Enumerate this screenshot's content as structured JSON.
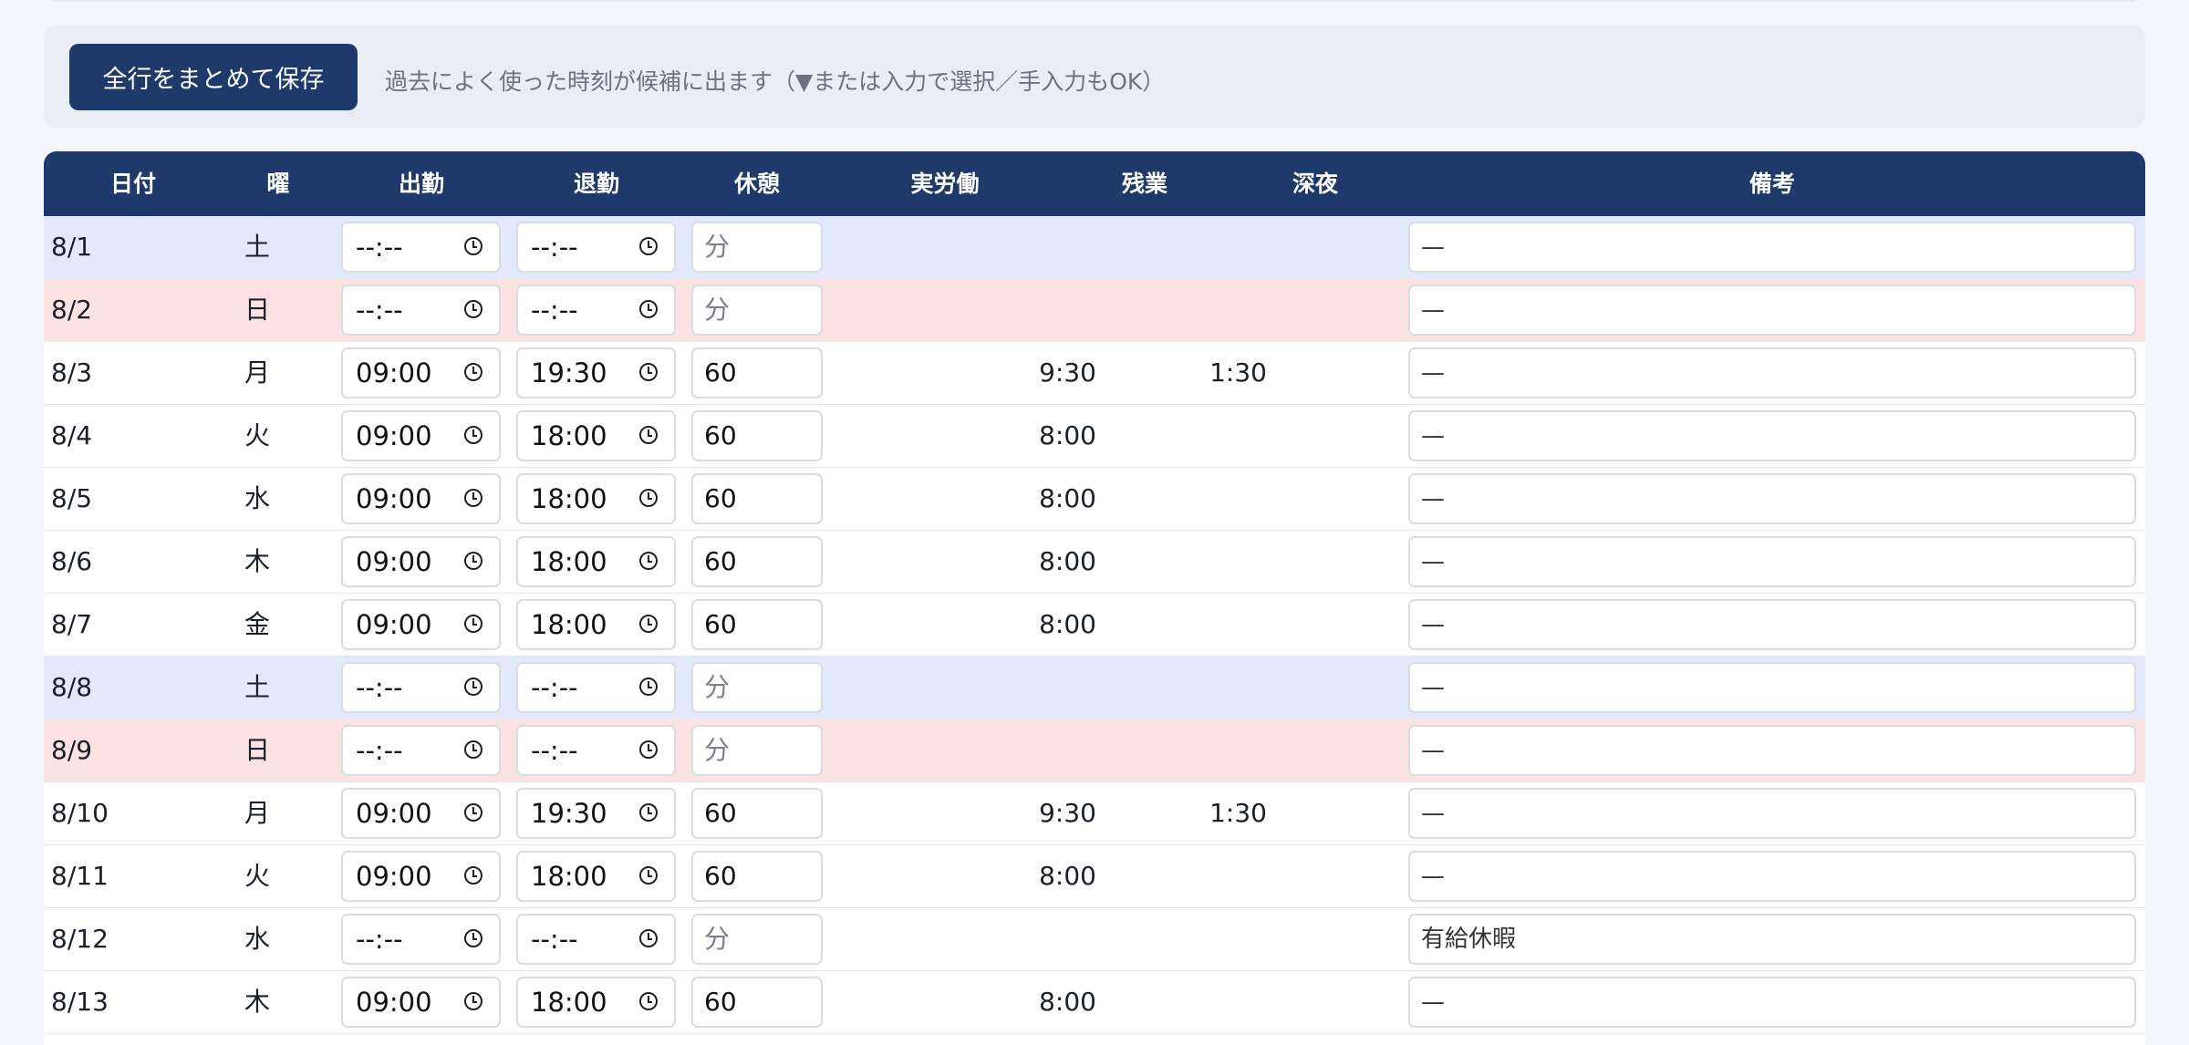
{
  "toolbar": {
    "save_label": "全行をまとめて保存",
    "hint": "過去によく使った時刻が候補に出ます（▼または入力で選択／手入力もOK）"
  },
  "table": {
    "headers": [
      "日付",
      "曜",
      "出勤",
      "退勤",
      "休憩",
      "実労働",
      "残業",
      "深夜",
      "備考"
    ],
    "rows": [
      {
        "date": "8/1",
        "dow": "土",
        "type": "sat",
        "start": "--:--",
        "end": "--:--",
        "break": "",
        "break_placeholder": "分",
        "work": "",
        "overtime": "",
        "night": "",
        "note": "—"
      },
      {
        "date": "8/2",
        "dow": "日",
        "type": "sun",
        "start": "--:--",
        "end": "--:--",
        "break": "",
        "break_placeholder": "分",
        "work": "",
        "overtime": "",
        "night": "",
        "note": "—"
      },
      {
        "date": "8/3",
        "dow": "月",
        "type": "weekday",
        "start": "09:00",
        "end": "19:30",
        "break": "60",
        "break_placeholder": "分",
        "work": "9:30",
        "overtime": "1:30",
        "night": "",
        "note": "—"
      },
      {
        "date": "8/4",
        "dow": "火",
        "type": "weekday",
        "start": "09:00",
        "end": "18:00",
        "break": "60",
        "break_placeholder": "分",
        "work": "8:00",
        "overtime": "",
        "night": "",
        "note": "—"
      },
      {
        "date": "8/5",
        "dow": "水",
        "type": "weekday",
        "start": "09:00",
        "end": "18:00",
        "break": "60",
        "break_placeholder": "分",
        "work": "8:00",
        "overtime": "",
        "night": "",
        "note": "—"
      },
      {
        "date": "8/6",
        "dow": "木",
        "type": "weekday",
        "start": "09:00",
        "end": "18:00",
        "break": "60",
        "break_placeholder": "分",
        "work": "8:00",
        "overtime": "",
        "night": "",
        "note": "—"
      },
      {
        "date": "8/7",
        "dow": "金",
        "type": "weekday",
        "start": "09:00",
        "end": "18:00",
        "break": "60",
        "break_placeholder": "分",
        "work": "8:00",
        "overtime": "",
        "night": "",
        "note": "—"
      },
      {
        "date": "8/8",
        "dow": "土",
        "type": "sat",
        "start": "--:--",
        "end": "--:--",
        "break": "",
        "break_placeholder": "分",
        "work": "",
        "overtime": "",
        "night": "",
        "note": "—"
      },
      {
        "date": "8/9",
        "dow": "日",
        "type": "sun",
        "start": "--:--",
        "end": "--:--",
        "break": "",
        "break_placeholder": "分",
        "work": "",
        "overtime": "",
        "night": "",
        "note": "—"
      },
      {
        "date": "8/10",
        "dow": "月",
        "type": "weekday",
        "start": "09:00",
        "end": "19:30",
        "break": "60",
        "break_placeholder": "分",
        "work": "9:30",
        "overtime": "1:30",
        "night": "",
        "note": "—"
      },
      {
        "date": "8/11",
        "dow": "火",
        "type": "weekday",
        "start": "09:00",
        "end": "18:00",
        "break": "60",
        "break_placeholder": "分",
        "work": "8:00",
        "overtime": "",
        "night": "",
        "note": "—"
      },
      {
        "date": "8/12",
        "dow": "水",
        "type": "weekday",
        "start": "--:--",
        "end": "--:--",
        "break": "",
        "break_placeholder": "分",
        "work": "",
        "overtime": "",
        "night": "",
        "note": "有給休暇"
      },
      {
        "date": "8/13",
        "dow": "木",
        "type": "weekday",
        "start": "09:00",
        "end": "18:00",
        "break": "60",
        "break_placeholder": "分",
        "work": "8:00",
        "overtime": "",
        "night": "",
        "note": "—"
      }
    ]
  },
  "colors": {
    "header_bg": "#1e3a6b",
    "saturday_row": "#e3e9fa",
    "sunday_row": "#fde2e4",
    "page_bg": "#f3f5fa"
  },
  "icons": {
    "time_picker": "clock-icon"
  }
}
